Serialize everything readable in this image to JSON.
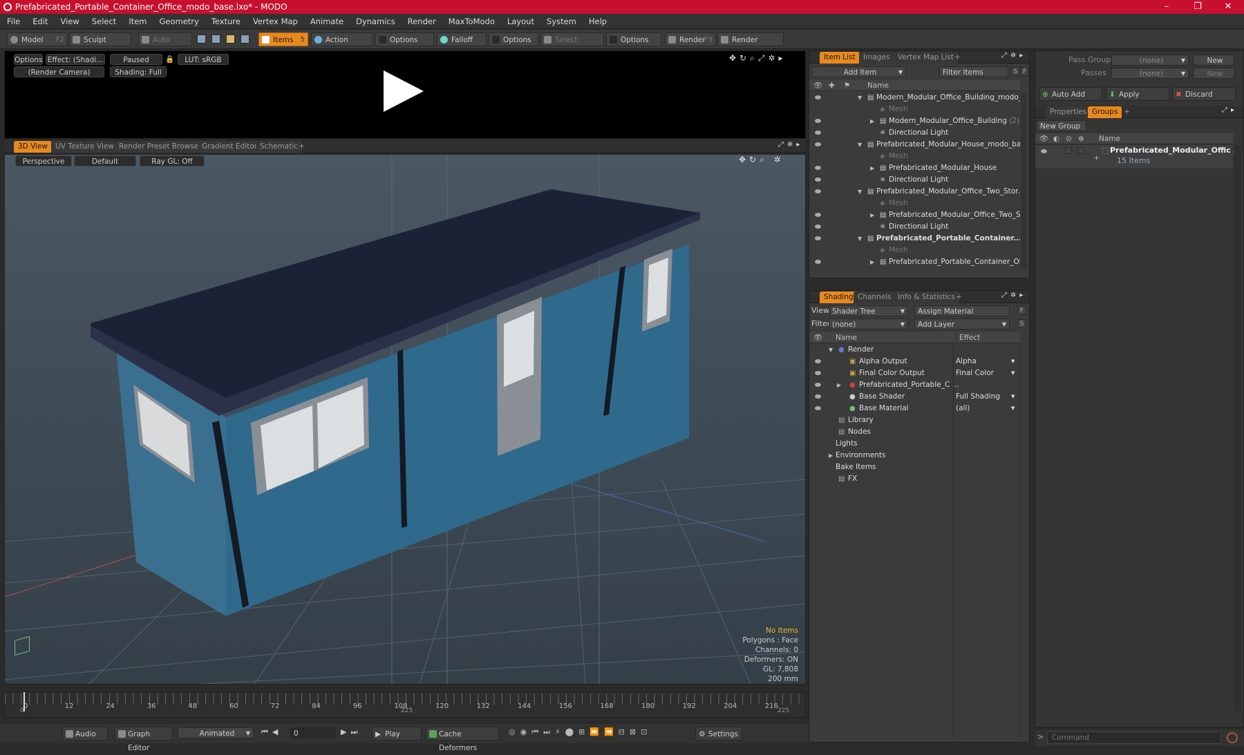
{
  "window": {
    "title": "Prefabricated_Portable_Container_Office_modo_base.lxo* - MODO",
    "minimize": "–",
    "maximize": "❐",
    "close": "✕"
  },
  "menu": [
    "File",
    "Edit",
    "View",
    "Select",
    "Item",
    "Geometry",
    "Texture",
    "Vertex Map",
    "Animate",
    "Dynamics",
    "Render",
    "MaxToModo",
    "Layout",
    "System",
    "Help"
  ],
  "toolbar": {
    "model": "Model",
    "model_key": "F2",
    "sculpt": "Sculpt",
    "auto_select": "Auto Select",
    "items": "Items",
    "items_key": "5",
    "action_center": "Action Center",
    "options1": "Options",
    "falloff": "Falloff",
    "options2": "Options",
    "select_through": "Select Through",
    "options3": "Options",
    "render": "Render",
    "render_key": "F9",
    "render_window": "Render Window"
  },
  "preview": {
    "options": "Options",
    "effect": "Effect: (Shadi...",
    "paused": "Paused",
    "lut": "LUT: sRGB",
    "camera": "(Render Camera)",
    "shading": "Shading: Full"
  },
  "view_tabs": [
    "3D View",
    "UV Texture View",
    "Render Preset Browser",
    "Gradient Editor",
    "Schematic",
    "+"
  ],
  "viewport": {
    "perspective": "Perspective",
    "default": "Default",
    "raygl": "Ray GL: Off",
    "stats": {
      "no_items": "No Items",
      "polygons": "Polygons : Face",
      "channels": "Channels: 0",
      "deformers": "Deformers: ON",
      "gl": "GL: 7,808",
      "size": "200 mm"
    }
  },
  "timeline": {
    "ticks": [
      "0",
      "12",
      "24",
      "36",
      "48",
      "60",
      "72",
      "84",
      "96",
      "108",
      "120",
      "132",
      "144",
      "156",
      "168",
      "180",
      "192",
      "204",
      "216"
    ],
    "start": "0",
    "mid": "225",
    "end": "225"
  },
  "bottombar": {
    "audio": "Audio",
    "graph_editor": "Graph Editor",
    "animated": "Animated",
    "frame": "0",
    "play": "Play",
    "cache": "Cache Deformers",
    "settings": "Settings"
  },
  "itemlist": {
    "tabs": [
      "Item List",
      "Images",
      "Vertex Map List",
      "+"
    ],
    "add_item": "Add Item",
    "filter_items": "Filter Items",
    "s": "S",
    "f": "F",
    "col_name": "Name",
    "rows": [
      {
        "label": "Modern_Modular_Office_Building_modo_...",
        "indent": 1,
        "kind": "scene"
      },
      {
        "label": "Mesh",
        "indent": 2,
        "kind": "mesh"
      },
      {
        "label": "Modern_Modular_Office_Building",
        "count": "(2)",
        "indent": 2,
        "kind": "group"
      },
      {
        "label": "Directional Light",
        "indent": 2,
        "kind": "light"
      },
      {
        "label": "Prefabricated_Modular_House_modo_ba...",
        "indent": 1,
        "kind": "scene"
      },
      {
        "label": "Mesh",
        "indent": 2,
        "kind": "mesh"
      },
      {
        "label": "Prefabricated_Modular_House",
        "indent": 2,
        "kind": "group"
      },
      {
        "label": "Directional Light",
        "indent": 2,
        "kind": "light"
      },
      {
        "label": "Prefabricated_Modular_Office_Two_Stor...",
        "indent": 1,
        "kind": "scene"
      },
      {
        "label": "Mesh",
        "indent": 2,
        "kind": "mesh"
      },
      {
        "label": "Prefabricated_Modular_Office_Two_S...",
        "indent": 2,
        "kind": "group"
      },
      {
        "label": "Directional Light",
        "indent": 2,
        "kind": "light"
      },
      {
        "label": "Prefabricated_Portable_Container...",
        "indent": 1,
        "kind": "scene",
        "bold": true
      },
      {
        "label": "Mesh",
        "indent": 2,
        "kind": "mesh"
      },
      {
        "label": "Prefabricated_Portable_Container_Of...",
        "indent": 2,
        "kind": "group"
      }
    ]
  },
  "shading": {
    "tabs": [
      "Shading",
      "Channels",
      "Info & Statistics",
      "+"
    ],
    "view_label": "View",
    "view_value": "Shader Tree",
    "assign_material": "Assign Material",
    "f": "F",
    "filter_label": "Filter",
    "filter_value": "(none)",
    "add_layer": "Add Layer",
    "s": "S",
    "col_name": "Name",
    "col_effect": "Effect",
    "rows": [
      {
        "label": "Render",
        "effect": "",
        "indent": 1
      },
      {
        "label": "Alpha Output",
        "effect": "Alpha",
        "indent": 2
      },
      {
        "label": "Final Color Output",
        "effect": "Final Color",
        "indent": 2
      },
      {
        "label": "Prefabricated_Portable_C ...",
        "effect": "",
        "indent": 2
      },
      {
        "label": "Base Shader",
        "effect": "Full Shading",
        "indent": 2
      },
      {
        "label": "Base Material",
        "effect": "(all)",
        "indent": 2
      },
      {
        "label": "Library",
        "effect": "",
        "indent": 1
      },
      {
        "label": "Nodes",
        "effect": "",
        "indent": 1
      },
      {
        "label": "Lights",
        "effect": "",
        "indent": 0
      },
      {
        "label": "Environments",
        "effect": "",
        "indent": 0
      },
      {
        "label": "Bake Items",
        "effect": "",
        "indent": 0
      },
      {
        "label": "FX",
        "effect": "",
        "indent": 1
      }
    ]
  },
  "groups": {
    "pass_groups": "Pass Groups",
    "pass_groups_value": "(none)",
    "new": "New",
    "passes": "Passes",
    "passes_value": "(none)",
    "new2": "New",
    "auto_add": "Auto Add",
    "apply": "Apply",
    "discard": "Discard",
    "tabs": [
      "Properties",
      "Groups",
      "+"
    ],
    "new_group": "New Group",
    "col_name": "Name",
    "group_name": "Prefabricated_Modular_Offic ...",
    "group_count": "15 Items"
  },
  "command": {
    "placeholder": "Command"
  },
  "colors": {
    "accent": "#e8891f",
    "titlebar": "#c8102e"
  }
}
